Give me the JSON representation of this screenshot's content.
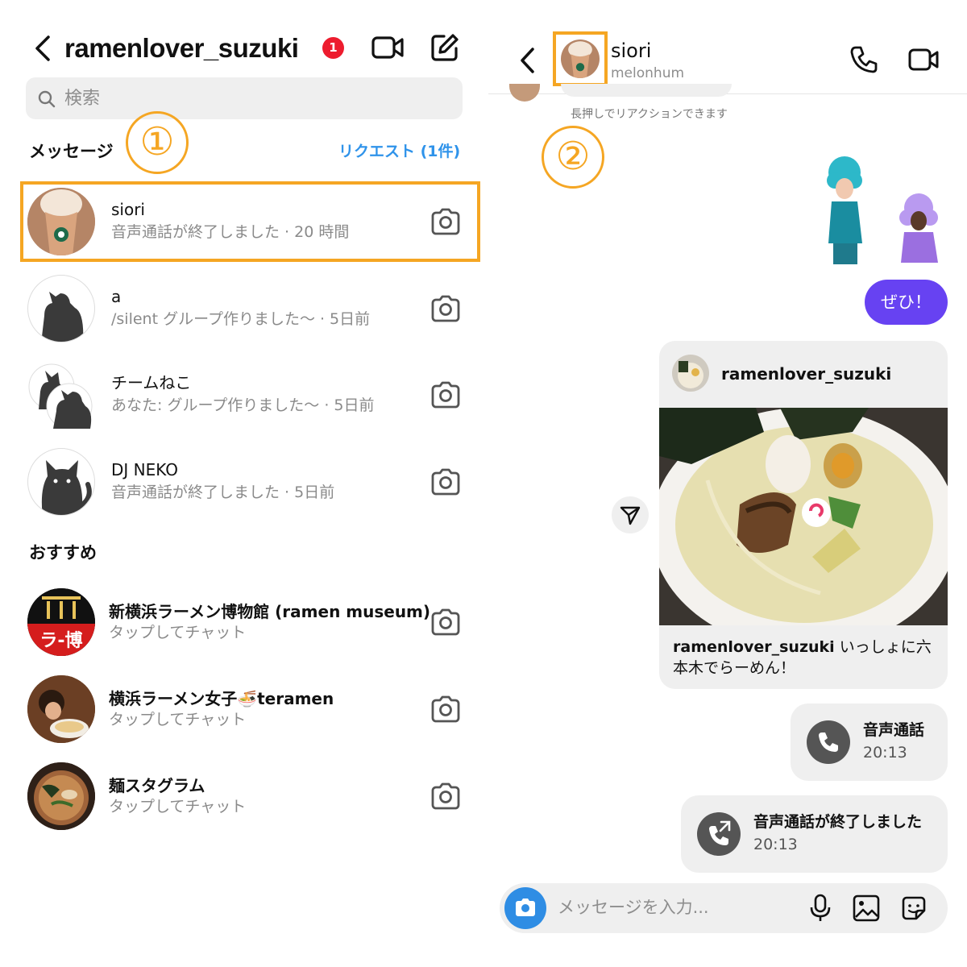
{
  "left": {
    "header": {
      "title": "ramenlover_suzuki",
      "badge": "1"
    },
    "search": {
      "placeholder": "検索"
    },
    "messages_label": "メッセージ",
    "requests_label": "リクエスト (1件)",
    "conversations": [
      {
        "name": "siori",
        "preview": "音声通話が終了しました · 20 時間"
      },
      {
        "name": "a",
        "preview": "/silent グループ作りました〜 · 5日前"
      },
      {
        "name": "チームねこ",
        "preview": "あなた: グループ作りました〜 · 5日前"
      },
      {
        "name": "DJ NEKO",
        "preview": "音声通話が終了しました · 5日前"
      }
    ],
    "suggested_label": "おすすめ",
    "suggested": [
      {
        "name": "新横浜ラーメン博物館 (ramen museum)",
        "preview": "タップしてチャット",
        "logo_text": "ラ-博"
      },
      {
        "name": "横浜ラーメン女子🍜teramen",
        "preview": "タップしてチャット"
      },
      {
        "name": "麺スタグラム",
        "preview": "タップしてチャット"
      }
    ]
  },
  "annotations": {
    "step1": "①",
    "step2": "②",
    "highlight_color": "#f5a623"
  },
  "right": {
    "header": {
      "name": "siori",
      "username": "melonhum"
    },
    "hint": "長押しでリアクションできます",
    "sent_message": "ぜひ！",
    "shared_post": {
      "username": "ramenlover_suzuki",
      "caption_user": "ramenlover_suzuki",
      "caption_text": " いっしょに六本木でらーめん！"
    },
    "calls": [
      {
        "title": "音声通話",
        "time": "20:13"
      },
      {
        "title": "音声通話が終了しました",
        "time": "20:13"
      }
    ],
    "composer": {
      "placeholder": "メッセージを入力..."
    }
  },
  "colors": {
    "accent_blue": "#2f93ea",
    "sent_bubble": "#6742f2",
    "badge_red": "#ed1c2e"
  }
}
